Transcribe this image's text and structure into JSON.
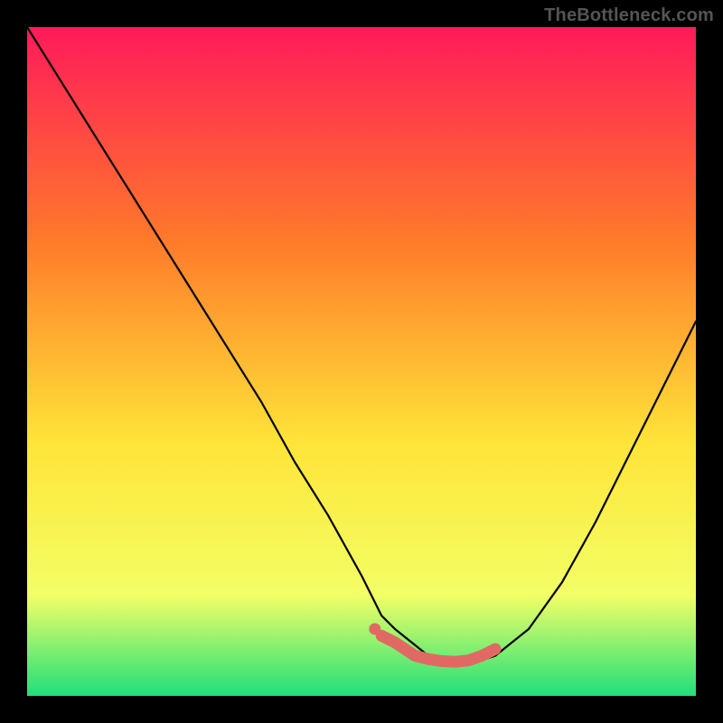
{
  "watermark": "TheBottleneck.com",
  "colors": {
    "page_bg": "#000000",
    "gradient_top": "#ff1a5a",
    "gradient_mid_upper": "#ff7a2a",
    "gradient_mid": "#ffe438",
    "gradient_lower": "#f2ff66",
    "gradient_bottom": "#1fe07a",
    "curve": "#000000",
    "valley_marker": "#e06a63"
  },
  "chart_data": {
    "type": "line",
    "title": "",
    "xlabel": "",
    "ylabel": "",
    "xlim": [
      0,
      100
    ],
    "ylim": [
      0,
      100
    ],
    "series": [
      {
        "name": "curve",
        "x": [
          0,
          5,
          10,
          15,
          20,
          25,
          30,
          35,
          40,
          45,
          50,
          53,
          55,
          60,
          63,
          67,
          70,
          75,
          80,
          85,
          90,
          95,
          100
        ],
        "values": [
          100,
          92,
          84,
          76,
          68,
          60,
          52,
          44,
          35,
          27,
          18,
          12,
          10,
          6,
          5,
          5,
          6,
          10,
          17,
          26,
          36,
          46,
          56
        ]
      }
    ],
    "valley_markers": {
      "x": [
        53,
        55,
        58,
        60,
        62,
        64,
        66,
        68,
        70
      ],
      "values": [
        9,
        8,
        6,
        5.5,
        5.2,
        5.1,
        5.3,
        6,
        7
      ]
    },
    "gradient_bands_percent_from_top": [
      {
        "color": "gradient_top",
        "stop": 0
      },
      {
        "color": "gradient_mid_upper",
        "stop": 32
      },
      {
        "color": "gradient_mid",
        "stop": 62
      },
      {
        "color": "gradient_lower",
        "stop": 85
      },
      {
        "color": "gradient_bottom",
        "stop": 100
      }
    ]
  }
}
